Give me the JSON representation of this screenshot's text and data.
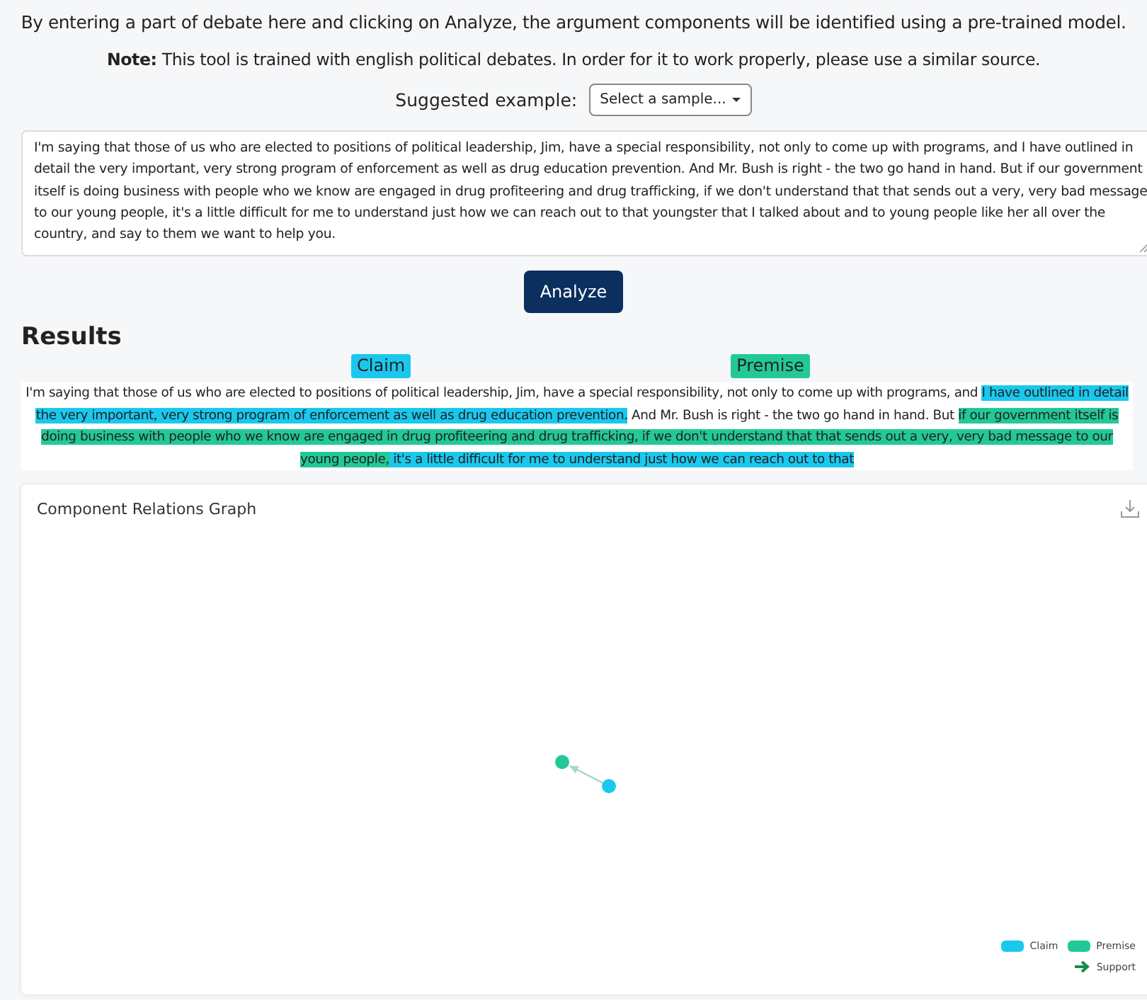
{
  "intro": "By entering a part of debate here and clicking on Analyze, the argument components will be identified using a pre-trained model.",
  "note": {
    "label": "Note:",
    "text": "This tool is trained with english political debates. In order for it to work properly, please use a similar source."
  },
  "sample": {
    "label": "Suggested example:",
    "dropdown": "Select a sample..."
  },
  "input_text": "I'm saying that those of us who are elected to positions of political leadership, Jim, have a special responsibility, not only to come up with programs, and I have outlined in detail the very important, very strong program of enforcement as well as drug education prevention. And Mr. Bush is right - the two go hand in hand. But if our government itself is doing business with people who we know are engaged in drug profiteering and drug trafficking, if we don't understand that that sends out a very, very bad message to our young people, it's a little difficult for me to understand just how we can reach out to that youngster that I talked about and to young people like her all over the country, and say to them we want to help you.",
  "analyze_button": "Analyze",
  "results": {
    "title": "Results",
    "labels": [
      {
        "text": "Claim",
        "color": "#1ac8ee"
      },
      {
        "text": "Premise",
        "color": "#22c997"
      }
    ],
    "segments": [
      {
        "kind": "plain",
        "text": "I'm saying that those of us who are elected to positions of political leadership, Jim, have a special responsibility, not only to come up with programs, and "
      },
      {
        "kind": "claim",
        "text": "I have outlined in detail the very important, very strong program of enforcement as well as drug education prevention."
      },
      {
        "kind": "plain",
        "text": " And Mr. Bush is right - the two go hand in hand. But "
      },
      {
        "kind": "premise",
        "text": "if our government itself is doing business with people who we know are engaged in drug profiteering and drug trafficking, if we don't understand that that sends out a very, very bad message to our young people,"
      },
      {
        "kind": "claim",
        "text": " it's a little difficult for me to understand just how we can reach out to that"
      }
    ]
  },
  "graph": {
    "title": "Component Relations Graph",
    "nodes": [
      {
        "color": "#22c997"
      },
      {
        "color": "#1ac8ee"
      }
    ],
    "edges": [
      {
        "kind": "support"
      }
    ],
    "legend": [
      {
        "text": "Claim",
        "color": "#1ac8ee"
      },
      {
        "text": "Premise",
        "color": "#22c997"
      }
    ],
    "relation_legend": [
      {
        "kind": "support",
        "text": "Support"
      }
    ]
  }
}
